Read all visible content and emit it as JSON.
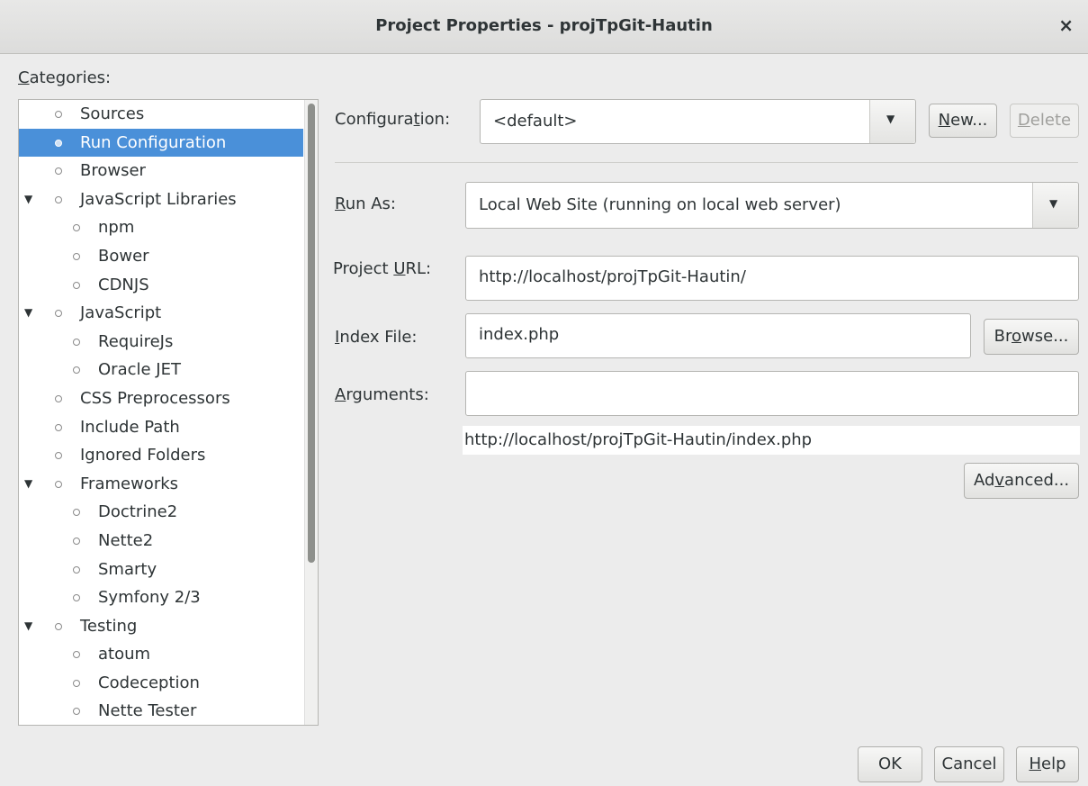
{
  "window": {
    "title": "Project Properties - projTpGit-Hautin",
    "close_glyph": "×"
  },
  "categories_label": "Categories:",
  "tree": {
    "items": [
      {
        "label": "Sources",
        "level": 0,
        "expander": false,
        "selected": false
      },
      {
        "label": "Run Configuration",
        "level": 0,
        "expander": false,
        "selected": true
      },
      {
        "label": "Browser",
        "level": 0,
        "expander": false,
        "selected": false
      },
      {
        "label": "JavaScript Libraries",
        "level": 0,
        "expander": true,
        "selected": false
      },
      {
        "label": "npm",
        "level": 1,
        "expander": false,
        "selected": false
      },
      {
        "label": "Bower",
        "level": 1,
        "expander": false,
        "selected": false
      },
      {
        "label": "CDNJS",
        "level": 1,
        "expander": false,
        "selected": false
      },
      {
        "label": "JavaScript",
        "level": 0,
        "expander": true,
        "selected": false
      },
      {
        "label": "RequireJs",
        "level": 1,
        "expander": false,
        "selected": false
      },
      {
        "label": "Oracle JET",
        "level": 1,
        "expander": false,
        "selected": false
      },
      {
        "label": "CSS Preprocessors",
        "level": 0,
        "expander": false,
        "selected": false
      },
      {
        "label": "Include Path",
        "level": 0,
        "expander": false,
        "selected": false
      },
      {
        "label": "Ignored Folders",
        "level": 0,
        "expander": false,
        "selected": false
      },
      {
        "label": "Frameworks",
        "level": 0,
        "expander": true,
        "selected": false
      },
      {
        "label": "Doctrine2",
        "level": 1,
        "expander": false,
        "selected": false
      },
      {
        "label": "Nette2",
        "level": 1,
        "expander": false,
        "selected": false
      },
      {
        "label": "Smarty",
        "level": 1,
        "expander": false,
        "selected": false
      },
      {
        "label": "Symfony 2/3",
        "level": 1,
        "expander": false,
        "selected": false
      },
      {
        "label": "Testing",
        "level": 0,
        "expander": true,
        "selected": false
      },
      {
        "label": "atoum",
        "level": 1,
        "expander": false,
        "selected": false
      },
      {
        "label": "Codeception",
        "level": 1,
        "expander": false,
        "selected": false
      },
      {
        "label": "Nette Tester",
        "level": 1,
        "expander": false,
        "selected": false
      }
    ]
  },
  "form": {
    "configuration_label": "Configuration:",
    "configuration_value": "<default>",
    "new_button": "New...",
    "delete_button": "Delete",
    "run_as_label": "Run As:",
    "run_as_value": "Local Web Site (running on local web server)",
    "project_url_label": "Project URL:",
    "project_url_value": "http://localhost/projTpGit-Hautin/",
    "index_file_label": "Index File:",
    "index_file_value": "index.php",
    "browse_button": "Browse...",
    "arguments_label": "Arguments:",
    "arguments_value": "",
    "resolved_url": "http://localhost/projTpGit-Hautin/index.php",
    "advanced_button": "Advanced..."
  },
  "footer": {
    "ok_button": "OK",
    "cancel_button": "Cancel",
    "help_button": "Help"
  },
  "icons": {
    "tree_bullet": "bullet-icon",
    "tree_expander": "triangle-down-icon",
    "combo_arrow": "chevron-down-icon"
  },
  "colors": {
    "selection": "#4a90d9",
    "window_bg": "#ececec"
  }
}
